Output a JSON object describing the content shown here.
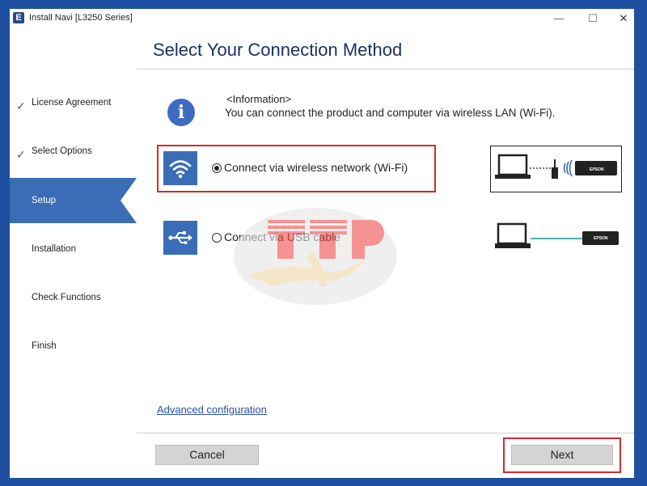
{
  "window": {
    "title": "Install Navi [L3250 Series]",
    "app_icon_letter": "E",
    "controls": {
      "minimize": "—",
      "maximize": "☐",
      "close": "✕"
    }
  },
  "sidebar": {
    "steps": [
      {
        "label": "License Agreement",
        "status": "done",
        "check": "✓"
      },
      {
        "label": "Select Options",
        "status": "done",
        "check": "✓"
      },
      {
        "label": "Setup",
        "status": "active"
      },
      {
        "label": "Installation",
        "status": "pending"
      },
      {
        "label": "Check Functions",
        "status": "pending"
      },
      {
        "label": "Finish",
        "status": "pending"
      }
    ]
  },
  "main": {
    "title": "Select Your Connection Method",
    "info": {
      "icon": "info-icon",
      "icon_glyph": "i",
      "heading": "<Information>",
      "text": "You can connect the product and computer via wireless LAN (Wi-Fi)."
    },
    "options": [
      {
        "label": "Connect via wireless network (Wi-Fi)",
        "selected": true,
        "icon": "wifi-icon"
      },
      {
        "label": "Connect via USB cable",
        "selected": false,
        "icon": "usb-icon"
      }
    ],
    "diagrams": {
      "printer_brand": "EPSON"
    },
    "advanced_link": "Advanced configuration"
  },
  "footer": {
    "cancel_label": "Cancel",
    "next_label": "Next"
  },
  "colors": {
    "accent": "#3a6db5",
    "frame": "#1f4fa0",
    "highlight": "#d42a2a",
    "link": "#2a4fa7",
    "title": "#1b2f5e"
  }
}
